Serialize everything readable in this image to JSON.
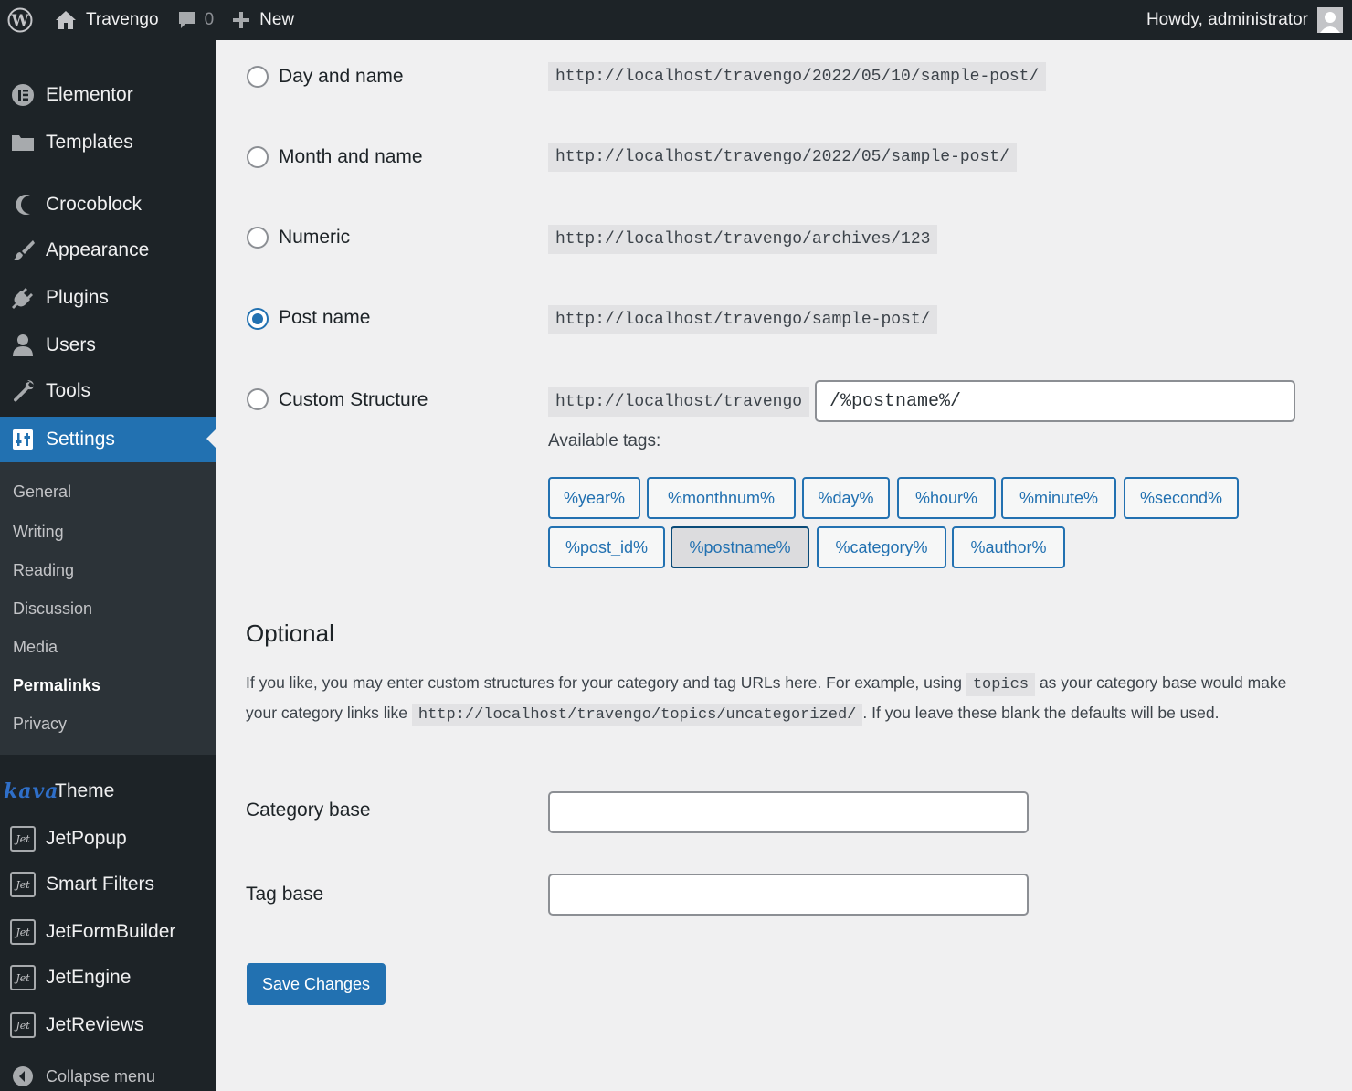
{
  "adminbar": {
    "site_name": "Travengo",
    "comments_count": "0",
    "new_label": "New",
    "howdy": "Howdy, administrator"
  },
  "sidebar": {
    "items": [
      {
        "label": "Elementor",
        "icon": "elementor-icon"
      },
      {
        "label": "Templates",
        "icon": "folder-icon"
      },
      {
        "label": "Crocoblock",
        "icon": "crocoblock-icon"
      },
      {
        "label": "Appearance",
        "icon": "brush-icon"
      },
      {
        "label": "Plugins",
        "icon": "plug-icon"
      },
      {
        "label": "Users",
        "icon": "user-icon"
      },
      {
        "label": "Tools",
        "icon": "wrench-icon"
      },
      {
        "label": "Settings",
        "icon": "settings-icon"
      }
    ],
    "submenu": [
      "General",
      "Writing",
      "Reading",
      "Discussion",
      "Media",
      "Permalinks",
      "Privacy"
    ],
    "theme": {
      "logo": "kava",
      "label": "Theme"
    },
    "jet_items": [
      "JetPopup",
      "Smart Filters",
      "JetFormBuilder",
      "JetEngine",
      "JetReviews"
    ],
    "jet_icon_text": "Jet",
    "collapse_label": "Collapse menu"
  },
  "permalinks": {
    "options": [
      {
        "label": "Day and name",
        "example": "http://localhost/travengo/2022/05/10/sample-post/",
        "checked": false
      },
      {
        "label": "Month and name",
        "example": "http://localhost/travengo/2022/05/sample-post/",
        "checked": false
      },
      {
        "label": "Numeric",
        "example": "http://localhost/travengo/archives/123",
        "checked": false
      },
      {
        "label": "Post name",
        "example": "http://localhost/travengo/sample-post/",
        "checked": true
      },
      {
        "label": "Custom Structure",
        "example": "http://localhost/travengo",
        "checked": false
      }
    ],
    "custom_value": "/%postname%/",
    "available_tags_label": "Available tags:",
    "tags": [
      "%year%",
      "%monthnum%",
      "%day%",
      "%hour%",
      "%minute%",
      "%second%",
      "%post_id%",
      "%postname%",
      "%category%",
      "%author%"
    ],
    "active_tag": "%postname%"
  },
  "optional": {
    "heading": "Optional",
    "para_1": "If you like, you may enter custom structures for your category and tag URLs here. For example, using",
    "para_code_1": "topics",
    "para_2": "as your category base would make your category links like",
    "para_code_2": "http://localhost/travengo/topics/uncategorized/",
    "para_3": ". If you leave these blank the defaults will be used.",
    "category_base_label": "Category base",
    "category_base_value": "",
    "tag_base_label": "Tag base",
    "tag_base_value": ""
  },
  "save_label": "Save Changes",
  "colors": {
    "accent": "#2271b1",
    "sidebar_bg": "#1d2327",
    "submenu_bg": "#2c3338",
    "page_bg": "#f0f0f1"
  }
}
